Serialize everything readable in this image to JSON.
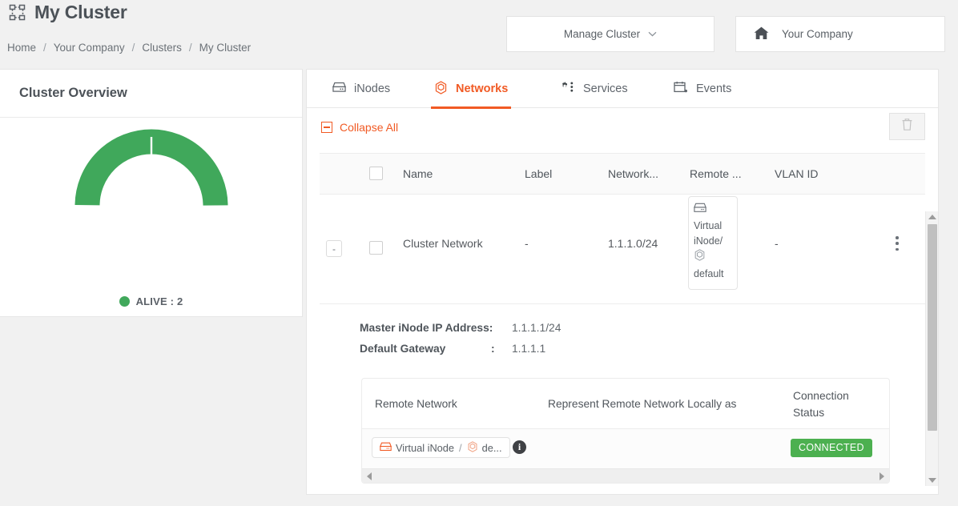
{
  "header": {
    "title": "My Cluster",
    "title_icon": "cluster-topology-icon",
    "breadcrumb": [
      "Home",
      "Your Company",
      "Clusters",
      "My Cluster"
    ],
    "breadcrumb_separator": "/",
    "manage_button": {
      "label": "Manage Cluster",
      "caret_icon": "chevron-down-icon"
    },
    "company_button": {
      "label": "Your Company",
      "icon": "home-icon"
    }
  },
  "left_panel": {
    "title": "Cluster Overview",
    "legend": [
      {
        "label": "ALIVE : 2",
        "color": "#40a85b"
      }
    ]
  },
  "chart_data": {
    "type": "pie",
    "title": "Cluster Overview",
    "variant": "donut",
    "categories": [
      "ALIVE"
    ],
    "values": [
      2
    ],
    "segments": [
      {
        "label": "ALIVE",
        "value": 1,
        "color": "#40a85b"
      },
      {
        "label": "ALIVE",
        "value": 1,
        "color": "#40a85b"
      }
    ],
    "total": 2,
    "legend_position": "bottom",
    "colors": [
      "#40a85b"
    ]
  },
  "tabs": [
    {
      "label": "iNodes",
      "icon": "inode-icon",
      "active": false
    },
    {
      "label": "Networks",
      "icon": "network-hexagon-icon",
      "active": true
    },
    {
      "label": "Services",
      "icon": "gears-icon",
      "active": false
    },
    {
      "label": "Events",
      "icon": "calendar-icon",
      "active": false
    }
  ],
  "toolbar": {
    "collapse_all_label": "Collapse All",
    "collapse_icon": "box-minus-icon",
    "delete_icon": "trash-icon",
    "delete_disabled": true
  },
  "networks_table": {
    "columns": [
      "Name",
      "Label",
      "Network...",
      "Remote ...",
      "VLAN ID"
    ],
    "select_all_checkbox": false,
    "rows": [
      {
        "expand_toggle": "-",
        "checkbox": false,
        "name": "Cluster Network",
        "label": "-",
        "network": "1.1.1.0/24",
        "remote": {
          "inode_icon": "inode-icon",
          "inode": "Virtual iNode/",
          "network_icon": "network-hexagon-icon",
          "network": "default"
        },
        "vlan_id": "-",
        "actions_icon": "kebab-menu-icon"
      }
    ]
  },
  "detail": {
    "master_ip_label": "Master iNode IP Address:",
    "master_ip_value": "1.1.1.1/24",
    "gateway_label": "Default Gateway",
    "gateway_colon": ":",
    "gateway_value": "1.1.1.1",
    "remote_table": {
      "columns": [
        "Remote Network",
        "Represent Remote Network Locally as",
        "Connection Status"
      ],
      "rows": [
        {
          "remote_chip_inode_icon": "inode-icon",
          "remote_chip_inode": "Virtual iNode",
          "remote_chip_slash": "/",
          "remote_chip_network_icon": "network-hexagon-icon",
          "remote_chip_network": "de...",
          "info_icon": "info-icon",
          "represent_as": "",
          "status": "CONNECTED",
          "status_color": "#4cb050"
        }
      ]
    }
  },
  "colors": {
    "accent": "#f15a24",
    "success": "#4cb050",
    "chart_green": "#40a85b",
    "page_bg": "#f1f1f1"
  }
}
